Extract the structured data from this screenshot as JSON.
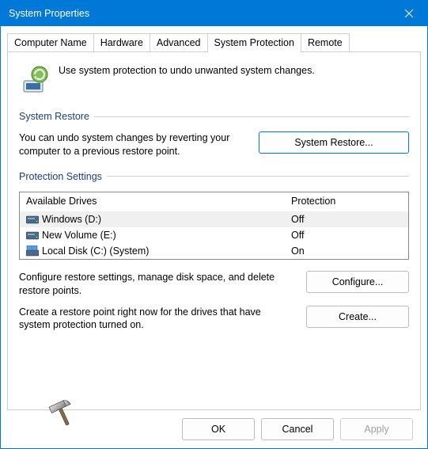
{
  "window": {
    "title": "System Properties"
  },
  "tabs": {
    "items": [
      "Computer Name",
      "Hardware",
      "Advanced",
      "System Protection",
      "Remote"
    ],
    "active": 3
  },
  "intro": "Use system protection to undo unwanted system changes.",
  "restore": {
    "group_title": "System Restore",
    "description": "You can undo system changes by reverting your computer to a previous restore point.",
    "button": "System Restore..."
  },
  "protection": {
    "group_title": "Protection Settings",
    "header_col1": "Available Drives",
    "header_col2": "Protection",
    "drives": [
      {
        "name": "Windows (D:)",
        "status": "Off",
        "icon": "hdd",
        "selected": true
      },
      {
        "name": "New Volume (E:)",
        "status": "Off",
        "icon": "hdd",
        "selected": false
      },
      {
        "name": "Local Disk (C:) (System)",
        "status": "On",
        "icon": "sys",
        "selected": false
      }
    ],
    "configure_text": "Configure restore settings, manage disk space, and delete restore points.",
    "configure_button": "Configure...",
    "create_text": "Create a restore point right now for the drives that have system protection turned on.",
    "create_button": "Create..."
  },
  "footer": {
    "ok": "OK",
    "cancel": "Cancel",
    "apply": "Apply"
  }
}
